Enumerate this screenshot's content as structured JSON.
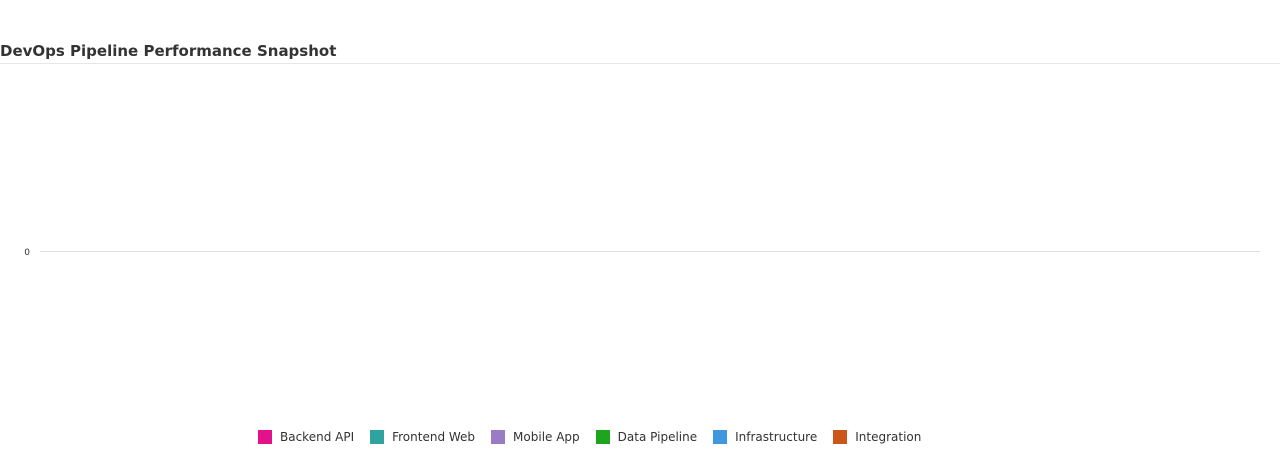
{
  "chart_data": {
    "type": "bar",
    "title": "DevOps Pipeline Performance Snapshot",
    "xlabel": "",
    "ylabel": "",
    "categories": [],
    "y_ticks": [
      "0"
    ],
    "grid": true,
    "legend_position": "bottom",
    "series": [
      {
        "name": "Backend API",
        "color": "#e3128c",
        "values": []
      },
      {
        "name": "Frontend Web",
        "color": "#2fa3a0",
        "values": []
      },
      {
        "name": "Mobile App",
        "color": "#9b7bc4",
        "values": []
      },
      {
        "name": "Data Pipeline",
        "color": "#1ea51e",
        "values": []
      },
      {
        "name": "Infrastructure",
        "color": "#3f97e0",
        "values": []
      },
      {
        "name": "Integration",
        "color": "#cc5519",
        "values": []
      }
    ]
  }
}
